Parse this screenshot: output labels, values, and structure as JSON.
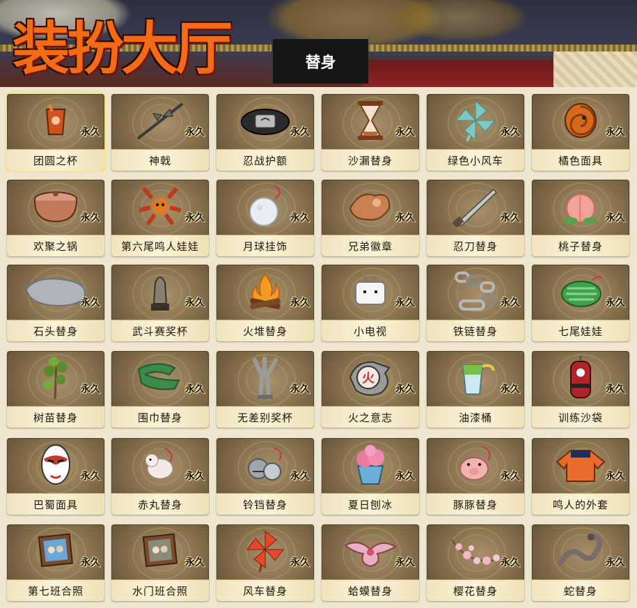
{
  "header": {
    "title": "装扮大厅",
    "tab_label": "替身"
  },
  "items": [
    {
      "name": "团圆之杯",
      "tag": "永久",
      "icon": "cup-icon",
      "color": "#d0531d",
      "selected": true
    },
    {
      "name": "神戟",
      "tag": "永久",
      "icon": "halberd-icon",
      "color": "#3a3a3a"
    },
    {
      "name": "忍战护额",
      "tag": "永久",
      "icon": "headband-icon",
      "color": "#2b2b2b"
    },
    {
      "name": "沙漏替身",
      "tag": "永久",
      "icon": "hourglass-icon",
      "color": "#b46a3a"
    },
    {
      "name": "绿色小风车",
      "tag": "永久",
      "icon": "pinwheel-icon",
      "color": "#7fc7c2"
    },
    {
      "name": "橘色面具",
      "tag": "永久",
      "icon": "mask-icon",
      "color": "#d56a1c"
    },
    {
      "name": "欢聚之锅",
      "tag": "永久",
      "icon": "pot-icon",
      "color": "#c07a5a"
    },
    {
      "name": "第六尾鸣人娃娃",
      "tag": "永久",
      "icon": "fox-doll-icon",
      "color": "#c0391b"
    },
    {
      "name": "月球挂饰",
      "tag": "永久",
      "icon": "moon-ornament-icon",
      "color": "#e8eef4"
    },
    {
      "name": "兄弟徽章",
      "tag": "永久",
      "icon": "badge-icon",
      "color": "#c98050"
    },
    {
      "name": "忍刀替身",
      "tag": "永久",
      "icon": "blade-icon",
      "color": "#8a8a7a"
    },
    {
      "name": "桃子替身",
      "tag": "永久",
      "icon": "peach-icon",
      "color": "#f3a39a"
    },
    {
      "name": "石头替身",
      "tag": "永久",
      "icon": "stone-icon",
      "color": "#aeb4ba"
    },
    {
      "name": "武斗赛奖杯",
      "tag": "永久",
      "icon": "trophy-icon",
      "color": "#8a8070"
    },
    {
      "name": "火堆替身",
      "tag": "永久",
      "icon": "campfire-icon",
      "color": "#f29a22"
    },
    {
      "name": "小电视",
      "tag": "永久",
      "icon": "tv-icon",
      "color": "#f4f4f4"
    },
    {
      "name": "铁链替身",
      "tag": "永久",
      "icon": "chain-icon",
      "color": "#b8b8b8"
    },
    {
      "name": "七尾娃娃",
      "tag": "永久",
      "icon": "bug-doll-icon",
      "color": "#3fa24a"
    },
    {
      "name": "树苗替身",
      "tag": "永久",
      "icon": "sapling-icon",
      "color": "#5c8a2c"
    },
    {
      "name": "围巾替身",
      "tag": "永久",
      "icon": "scarf-icon",
      "color": "#3e8a4a"
    },
    {
      "name": "无差别奖杯",
      "tag": "永久",
      "icon": "claw-trophy-icon",
      "color": "#9a9a9a"
    },
    {
      "name": "火之意志",
      "tag": "永久",
      "icon": "fire-will-icon",
      "color": "#c0392b"
    },
    {
      "name": "油漆桶",
      "tag": "永久",
      "icon": "paint-bucket-icon",
      "color": "#7bbf4a"
    },
    {
      "name": "训练沙袋",
      "tag": "永久",
      "icon": "sandbag-icon",
      "color": "#b3232a"
    },
    {
      "name": "巴蜀面具",
      "tag": "永久",
      "icon": "opera-mask-icon",
      "color": "#ffffff"
    },
    {
      "name": "赤丸替身",
      "tag": "永久",
      "icon": "dog-icon",
      "color": "#f3ece6"
    },
    {
      "name": "铃铛替身",
      "tag": "永久",
      "icon": "bells-icon",
      "color": "#a0a6ad"
    },
    {
      "name": "夏日刨冰",
      "tag": "永久",
      "icon": "shaved-ice-icon",
      "color": "#e87aa0"
    },
    {
      "name": "豚豚替身",
      "tag": "永久",
      "icon": "pig-icon",
      "color": "#f2b3b0"
    },
    {
      "name": "鸣人的外套",
      "tag": "永久",
      "icon": "jacket-icon",
      "color": "#e76b2a"
    },
    {
      "name": "第七班合照",
      "tag": "永久",
      "icon": "photo-frame-icon",
      "color": "#6aa6d6"
    },
    {
      "name": "水门班合照",
      "tag": "永久",
      "icon": "photo-frame-icon",
      "color": "#8a8a7a"
    },
    {
      "name": "风车替身",
      "tag": "永久",
      "icon": "pinwheel-red-icon",
      "color": "#e4492a"
    },
    {
      "name": "蛤蟆替身",
      "tag": "永久",
      "icon": "toad-icon",
      "color": "#e7b0c0"
    },
    {
      "name": "樱花替身",
      "tag": "永久",
      "icon": "sakura-icon",
      "color": "#f2b6c8"
    },
    {
      "name": "蛇替身",
      "tag": "永久",
      "icon": "snake-icon",
      "color": "#7a6a6a"
    }
  ]
}
